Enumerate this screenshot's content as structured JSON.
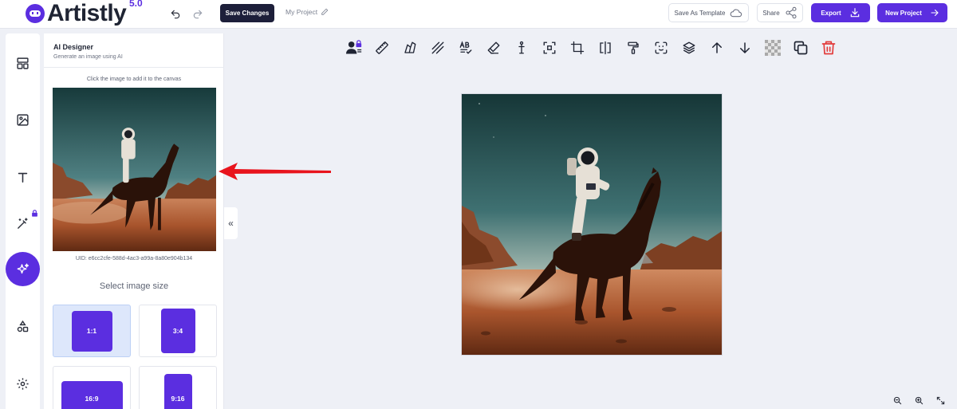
{
  "app": {
    "name": "Artistly",
    "version": "5.0"
  },
  "topbar": {
    "save_changes": "Save Changes",
    "project_name": "My Project",
    "save_as_template": "Save As Template",
    "share": "Share",
    "export": "Export",
    "new_project": "New Project"
  },
  "rail": {
    "items": [
      "layout-icon",
      "image-icon",
      "text-icon",
      "magic-wand-icon",
      "sparkles-icon",
      "shapes-icon",
      "settings-icon"
    ],
    "active": "sparkles-icon"
  },
  "panel": {
    "title": "AI Designer",
    "subtitle": "Generate an image using AI",
    "hint": "Click the image to add it to the canvas",
    "uid": "UID: e6cc2cfe-588d-4ac3-a99a-8a80e904b134",
    "size_title": "Select image size",
    "sizes": [
      {
        "label": "1:1",
        "selected": true
      },
      {
        "label": "3:4",
        "selected": false
      },
      {
        "label": "16:9",
        "selected": false
      },
      {
        "label": "9:16",
        "selected": false
      }
    ],
    "collapse_glyph": "«"
  },
  "toolbar": {
    "tools": [
      "user-lock-icon",
      "ruler-icon",
      "tilt-icon",
      "stripes-icon",
      "spellcheck-icon",
      "eraser-icon",
      "anchor-icon",
      "focus-icon",
      "crop-icon",
      "flip-icon",
      "paint-roller-icon",
      "scan-face-icon",
      "layers-icon",
      "arrow-up-icon",
      "arrow-down-icon",
      "transparency-icon",
      "duplicate-icon",
      "trash-icon"
    ]
  },
  "colors": {
    "accent": "#5b2ee0",
    "dark_button": "#1d1f3a",
    "danger": "#e23a3a",
    "annotation_arrow": "#e8141d"
  }
}
